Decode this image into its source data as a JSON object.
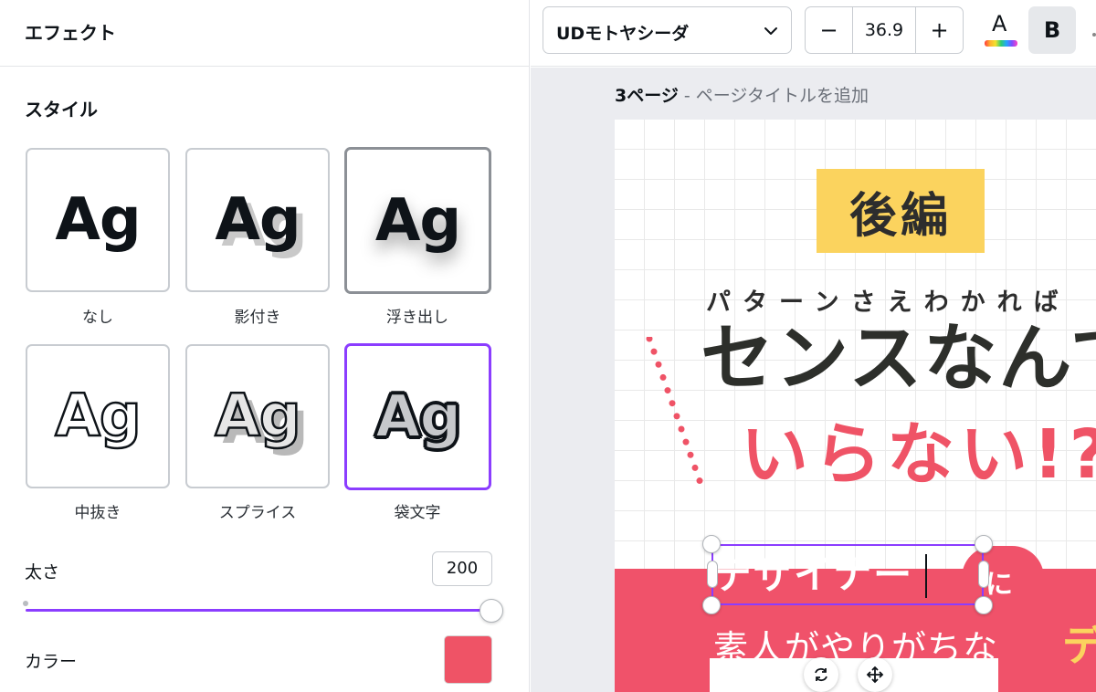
{
  "effects_panel": {
    "title": "エフェクト",
    "style_section": "スタイル",
    "styles": [
      {
        "sample": "Ag",
        "label": "なし"
      },
      {
        "sample": "Ag",
        "label": "影付き"
      },
      {
        "sample": "Ag",
        "label": "浮き出し"
      },
      {
        "sample": "Ag",
        "label": "中抜き"
      },
      {
        "sample": "Ag",
        "label": "スプライス"
      },
      {
        "sample": "Ag",
        "label": "袋文字"
      }
    ],
    "selected_style": "袋文字",
    "thickness_label": "太さ",
    "thickness_value": "200",
    "thickness_fraction": 1.0,
    "color_label": "カラー",
    "color_value": "#ef5366"
  },
  "toolbar": {
    "font_name": "UDモトヤシーダ",
    "size_minus": "−",
    "font_size": "36.9",
    "size_plus": "+",
    "text_color_letter": "A",
    "bold_label": "B"
  },
  "canvas": {
    "page_number": "3ページ",
    "page_title_separator": " - ",
    "page_title_placeholder": "ページタイトルを追加",
    "design": {
      "tag": "後編",
      "subheading": "パターンさえわかれば",
      "headline": "センスなんて",
      "headline2": "いらない!?",
      "band_title": "デザイナー",
      "band_particle": "に",
      "band_line": "素人がやりがちな",
      "band_accent": "デ"
    },
    "colors": {
      "accent_pink": "#f0526a",
      "accent_yellow": "#fbd35e",
      "selection": "#8b3dff"
    },
    "controls": {
      "rotate_icon": "rotate-icon",
      "move_icon": "move-icon"
    }
  }
}
